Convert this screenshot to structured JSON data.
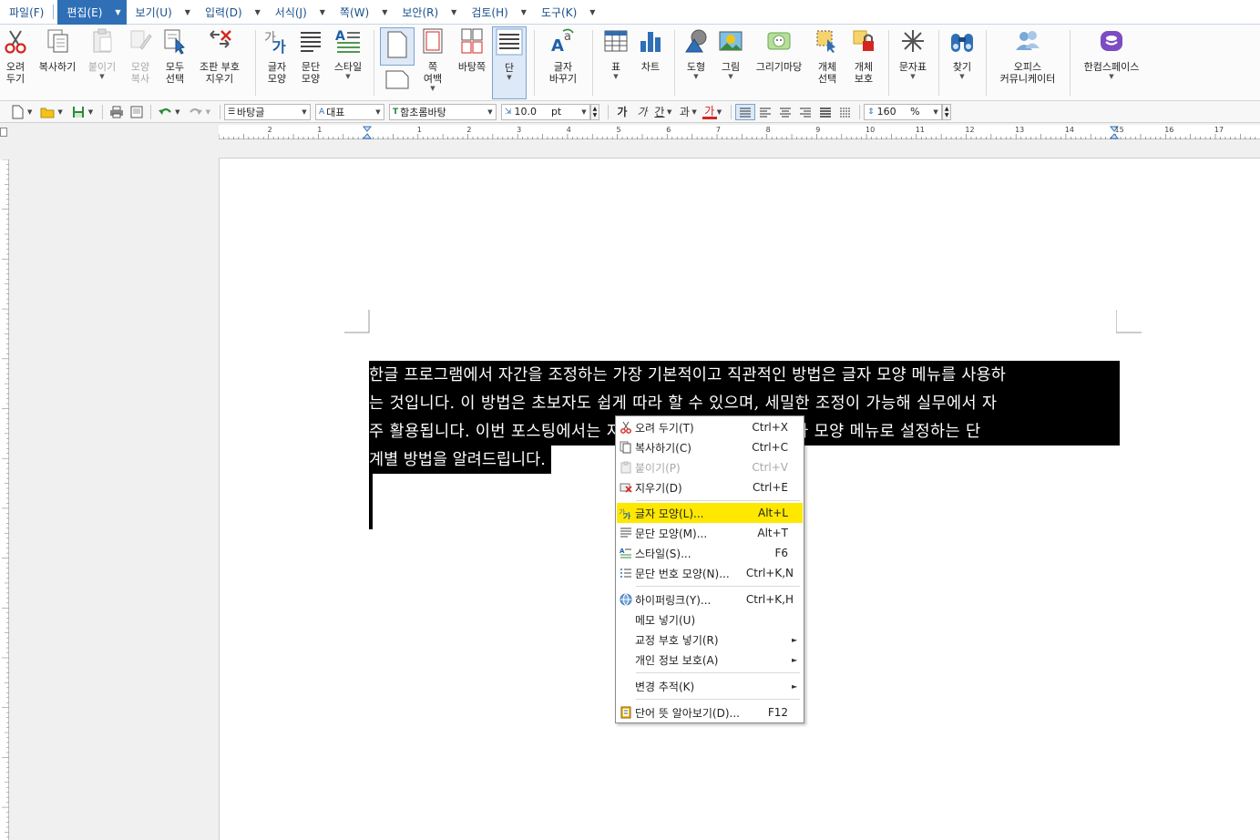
{
  "menubar": {
    "items": [
      {
        "label": "파일(F)"
      },
      {
        "label": "편집(E)"
      },
      {
        "label": "보기(U)"
      },
      {
        "label": "입력(D)"
      },
      {
        "label": "서식(J)"
      },
      {
        "label": "쪽(W)"
      },
      {
        "label": "보안(R)"
      },
      {
        "label": "검토(H)"
      },
      {
        "label": "도구(K)"
      }
    ]
  },
  "ribbon": {
    "cut": "오려\n두기",
    "copy": "복사하기",
    "paste": "붙이기",
    "format_copy": "모양\n복사",
    "select_all": "모두\n선택",
    "clear_marks": "조판 부호\n지우기",
    "char_shape": "글자\n모양",
    "para_shape": "문단\n모양",
    "style": "스타일",
    "page_margin": "쪽\n여백",
    "bg_page": "바탕쪽",
    "column": "단",
    "char_replace": "글자\n바꾸기",
    "table": "표",
    "chart": "차트",
    "shape": "도형",
    "picture": "그림",
    "drawing": "그리기마당",
    "obj_select": "개체\n선택",
    "obj_protect": "개체\n보호",
    "symbol": "문자표",
    "find": "찾기",
    "office_comm": "오피스\n커뮤니케이터",
    "hancom_space": "한컴스페이스"
  },
  "format_bar": {
    "style_value": "바탕글",
    "lang_value": "대표",
    "font_value": "함초롬바탕",
    "size_value": "10.0",
    "size_unit": "pt",
    "bold": "가",
    "italic": "가",
    "underline": "간",
    "strike": "과",
    "color_char": "가",
    "line_spacing_value": "160",
    "line_spacing_unit": "%"
  },
  "ruler": {
    "labels": [
      "2",
      "1",
      "1",
      "2",
      "3",
      "4",
      "5",
      "6",
      "7",
      "8",
      "9",
      "10",
      "11",
      "12",
      "13",
      "14",
      "15",
      "16",
      "17"
    ]
  },
  "document": {
    "lines": [
      "한글 프로그램에서 자간을 조정하는 가장 기본적이고 직관적인 방법은 글자 모양 메뉴를 사용하",
      "는 것입니다. 이 방법은 초보자도 쉽게 따라 할 수 있으며, 세밀한 조정이 가능해 실무에서 자",
      "주 활용됩니다. 이번 포스팅에서는 자간 줄이기 및 늘리기를 글자 모양 메뉴로 설정하는 단",
      "계별 방법을 알려드립니다."
    ]
  },
  "context_menu": {
    "items": [
      {
        "label": "오려 두기(T)",
        "shortcut": "Ctrl+X"
      },
      {
        "label": "복사하기(C)",
        "shortcut": "Ctrl+C"
      },
      {
        "label": "붙이기(P)",
        "shortcut": "Ctrl+V"
      },
      {
        "label": "지우기(D)",
        "shortcut": "Ctrl+E"
      },
      {
        "label": "글자 모양(L)...",
        "shortcut": "Alt+L"
      },
      {
        "label": "문단 모양(M)...",
        "shortcut": "Alt+T"
      },
      {
        "label": "스타일(S)...",
        "shortcut": "F6"
      },
      {
        "label": "문단 번호 모양(N)...",
        "shortcut": "Ctrl+K,N"
      },
      {
        "label": "하이퍼링크(Y)...",
        "shortcut": "Ctrl+K,H"
      },
      {
        "label": "메모 넣기(U)",
        "shortcut": ""
      },
      {
        "label": "교정 부호 넣기(R)",
        "shortcut": ""
      },
      {
        "label": "개인 정보 보호(A)",
        "shortcut": ""
      },
      {
        "label": "변경 추적(K)",
        "shortcut": ""
      },
      {
        "label": "단어 뜻 알아보기(D)...",
        "shortcut": "F12"
      }
    ]
  },
  "colors": {
    "accent": "#2f6fb6",
    "highlight": "#ffe800",
    "selection": "#000000"
  }
}
